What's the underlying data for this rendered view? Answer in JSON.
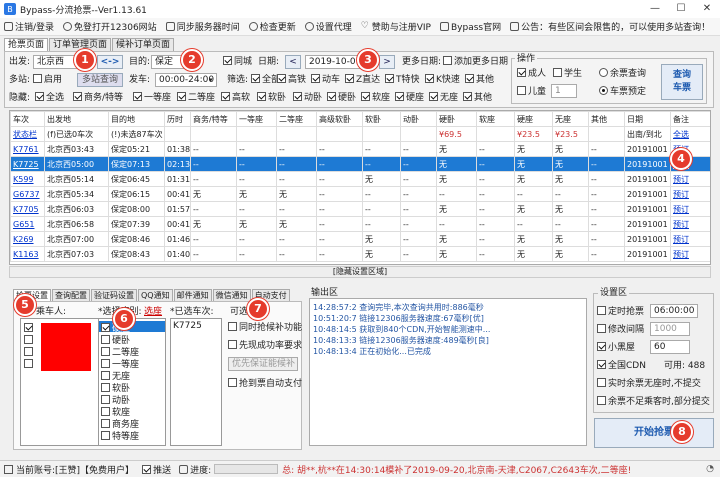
{
  "window": {
    "title": "Bypass-分流抢票--Ver1.13.61",
    "min": "—",
    "max": "☐",
    "close": "✕"
  },
  "menu": [
    {
      "label": "注销/登录",
      "icon": "user-icon"
    },
    {
      "label": "免登打开12306网站",
      "icon": "globe-icon"
    },
    {
      "label": "同步服务器时间",
      "icon": "clock-icon"
    },
    {
      "label": "检查更新",
      "icon": "refresh-icon"
    },
    {
      "label": "设置代理",
      "icon": "gear-icon"
    },
    {
      "label": "赞助与注册VIP",
      "icon": "heart-icon"
    },
    {
      "label": "Bypass官网",
      "icon": "home-icon"
    },
    {
      "label": "公告：有些区间会限售的，可以使用多站查询！",
      "icon": "speaker-icon"
    }
  ],
  "top_tabs": [
    "抢票页面",
    "订单管理页面",
    "候补订单页面"
  ],
  "query": {
    "from_label": "出发:",
    "from": "北京西",
    "swap": "<->",
    "to_label": "目的:",
    "to": "保定",
    "same_city": "同城",
    "date_label": "日期:",
    "date": "2019-10-01",
    "prev": "<",
    "next": ">",
    "more_dates_label": "更多日期:",
    "add_more_dates": "添加更多日期",
    "multi_label": "多站:",
    "enable": "启用",
    "multi_query_btn": "多站查询",
    "depart_label": "发车:",
    "depart_time": "00:00-24:00",
    "filter_label": "筛选:",
    "filters": [
      "全部",
      "高铁",
      "动车",
      "Z直达",
      "T特快",
      "K快速",
      "其他"
    ],
    "hide_label": "隐藏:",
    "hides": [
      "全选",
      "商务/特等",
      "一等座",
      "二等座",
      "高软",
      "软卧",
      "动卧",
      "硬卧",
      "软座",
      "硬座",
      "无座",
      "其他"
    ],
    "ops_title": "操作",
    "adult": "成人",
    "student": "学生",
    "child": "儿童",
    "child_count": "1",
    "remaining_query": "余票查询",
    "train_booking": "车票预定",
    "query_btn": "查询\n车票"
  },
  "badges": [
    "1",
    "2",
    "3",
    "4",
    "5",
    "6",
    "7",
    "8"
  ],
  "table": {
    "headers": [
      "车次",
      "出发地",
      "目的地",
      "历时",
      "商务/特等",
      "一等座",
      "二等座",
      "高级软卧",
      "软卧",
      "动卧",
      "硬卧",
      "软座",
      "硬座",
      "无座",
      "其他",
      "日期",
      "备注"
    ],
    "rows": [
      [
        "状态栏",
        "(f)已选0车次",
        "(!)未选87车次",
        "",
        "",
        "",
        "",
        "",
        "",
        "",
        "¥69.5",
        "",
        "¥23.5",
        "¥23.5",
        "",
        "出南/到北",
        "全选"
      ],
      [
        "K7761",
        "北京西03:43",
        "保定05:21",
        "01:38",
        "--",
        "--",
        "--",
        "--",
        "--",
        "--",
        "无",
        "--",
        "无",
        "无",
        "--",
        "20191001",
        "预订"
      ],
      [
        "K7725",
        "北京西05:00",
        "保定07:13",
        "02:13",
        "--",
        "--",
        "--",
        "--",
        "--",
        "--",
        "无",
        "--",
        "无",
        "无",
        "--",
        "20191001",
        "预订"
      ],
      [
        "K599",
        "北京西05:14",
        "保定06:45",
        "01:31",
        "--",
        "--",
        "--",
        "--",
        "无",
        "--",
        "无",
        "--",
        "无",
        "无",
        "--",
        "20191001",
        "预订"
      ],
      [
        "G6737",
        "北京西05:34",
        "保定06:15",
        "00:41",
        "无",
        "无",
        "无",
        "--",
        "--",
        "--",
        "--",
        "--",
        "--",
        "--",
        "--",
        "20191001",
        "预订"
      ],
      [
        "K7705",
        "北京西06:03",
        "保定08:00",
        "01:57",
        "--",
        "--",
        "--",
        "--",
        "--",
        "--",
        "无",
        "--",
        "无",
        "无",
        "--",
        "20191001",
        "预订"
      ],
      [
        "G651",
        "北京西06:58",
        "保定07:39",
        "00:41",
        "无",
        "无",
        "无",
        "--",
        "--",
        "--",
        "--",
        "--",
        "--",
        "--",
        "--",
        "20191001",
        "预订"
      ],
      [
        "K269",
        "北京西07:00",
        "保定08:46",
        "01:46",
        "--",
        "--",
        "--",
        "--",
        "无",
        "--",
        "无",
        "--",
        "无",
        "无",
        "--",
        "20191001",
        "预订"
      ],
      [
        "K1163",
        "北京西07:03",
        "保定08:43",
        "01:40",
        "--",
        "--",
        "--",
        "--",
        "无",
        "--",
        "无",
        "--",
        "无",
        "无",
        "--",
        "20191001",
        "预订"
      ]
    ]
  },
  "hide_settings": "[隐藏设置区域]",
  "bottom_tabs": [
    "抢票设置",
    "查询配置",
    "验证码设置",
    "QQ通知",
    "邮件通知",
    "微信通知",
    "自动支付"
  ],
  "settings": {
    "passengers_label": "乘车人:",
    "seats_label": "*选择席别:",
    "seats_link": "选座",
    "seats": [
      "硬座",
      "硬卧",
      "二等座",
      "一等座",
      "无座",
      "软卧",
      "动卧",
      "软座",
      "商务座",
      "特等座"
    ],
    "trains_label": "*已选车次:",
    "selected_train": "K7725",
    "options_label": "可选设置:",
    "opt1": "同时抢候补功能",
    "opt2": "先现成功率要求",
    "opt_select": "优先保证能候补",
    "opt3": "抢到票自动支付"
  },
  "output": {
    "title": "输出区",
    "lines": [
      "14:28:57:2    查询完毕,本次查询共用时:886毫秒",
      "10:51:20:7    链接12306服务器速度:67毫秒[优]",
      "10:48:14:5    获取到840个CDN,开始智能测速中...",
      "10:48:13:3    链接12306服务器速度:489毫秒[良]",
      "10:48:13:4    正在初始化...已完成"
    ]
  },
  "settings_area": {
    "title": "设置区",
    "timed": "定时抢票",
    "timed_value": "06:00:00",
    "interval": "修改间隔",
    "interval_value": "1000",
    "blackroom": "小黑屋",
    "blackroom_value": "60",
    "cdn": "全国CDN",
    "cdn_avail": "可用: 488",
    "opt_a": "实时余票无座时,不提交",
    "opt_b": "余票不足乘客时,部分提交",
    "start_btn": "开始抢票"
  },
  "status": {
    "account": "当前账号:[王赞]【免费用户】",
    "push": "推送",
    "progress": "进度:",
    "ticker": "总: 胡**,杭**在14:30:14模补了2019-09-20,北京南-天津,C2067,C2643车次,二等座!"
  },
  "colors": {
    "accent": "#1e7ad4",
    "badge": "#e53b2c",
    "selected_row": "#1e7ad4",
    "passenger_red": "#ff0000"
  }
}
